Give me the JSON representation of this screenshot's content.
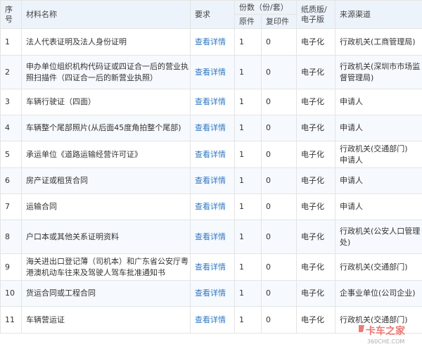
{
  "header": {
    "index": "序\n号",
    "name": "材料名称",
    "requirement": "要求",
    "copies": "份数（份/套）",
    "original": "原件",
    "copy": "复印件",
    "format": "纸质版/\n电子版",
    "source": "来源渠道"
  },
  "rows": [
    {
      "index": "1",
      "name": "法人代表证明及法人身份证明",
      "link": "查看详情",
      "original": "1",
      "copy": "0",
      "format": "电子化",
      "source": "行政机关(工商管理局)"
    },
    {
      "index": "2",
      "name": "申办单位组织机构代码证或四证合一后的营业执照扫描件（四证合一后的新营业执照）",
      "link": "查看详情",
      "original": "1",
      "copy": "0",
      "format": "电子化",
      "source": "行政机关(深圳市市场监督管理局)"
    },
    {
      "index": "3",
      "name": "车辆行驶证（四面）",
      "link": "查看详情",
      "original": "1",
      "copy": "0",
      "format": "电子化",
      "source": "申请人"
    },
    {
      "index": "4",
      "name": "车辆整个尾部照片(从后面45度角拍整个尾部)",
      "link": "查看详情",
      "original": "1",
      "copy": "0",
      "format": "电子化",
      "source": "申请人"
    },
    {
      "index": "5",
      "name": "承运单位《道路运输经营许可证》",
      "link": "查看详情",
      "original": "1",
      "copy": "0",
      "format": "电子化",
      "source": "行政机关(交通部门)\n申请人"
    },
    {
      "index": "6",
      "name": "房产证或租赁合同",
      "link": "查看详情",
      "original": "1",
      "copy": "0",
      "format": "电子化",
      "source": "申请人"
    },
    {
      "index": "7",
      "name": "运输合同",
      "link": "查看详情",
      "original": "1",
      "copy": "0",
      "format": "电子化",
      "source": "申请人"
    },
    {
      "index": "8",
      "name": "户口本或其他关系证明资料",
      "link": "查看详情",
      "original": "1",
      "copy": "0",
      "format": "电子化",
      "source": "行政机关(公安人口管理处)"
    },
    {
      "index": "9",
      "name": "海关进出口登记薄（司机本）和广东省公安厅粤港澳机动车往来及驾驶人驾车批准通知书",
      "link": "查看详情",
      "original": "1",
      "copy": "0",
      "format": "电子化",
      "source": "行政机关(交通部门)"
    },
    {
      "index": "10",
      "name": "货运合同或工程合同",
      "link": "查看详情",
      "original": "1",
      "copy": "0",
      "format": "电子化",
      "source": "企事业单位(公司企业)"
    },
    {
      "index": "11",
      "name": "车辆营运证",
      "link": "查看详情",
      "original": "1",
      "copy": "0",
      "format": "电子化",
      "source": "行政机关(交通部门)"
    }
  ],
  "watermark": {
    "text": "卡车之家",
    "sub": "360CHE.COM",
    "color": "#e2504a"
  }
}
